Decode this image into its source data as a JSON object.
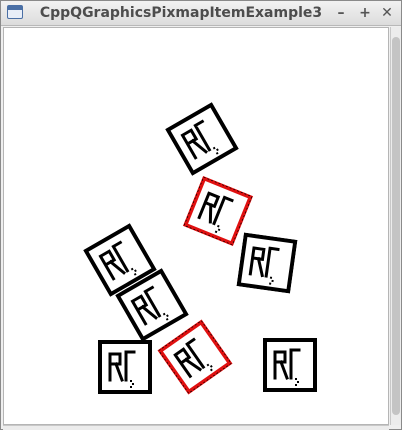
{
  "window": {
    "title": "CppQGraphicsPixmapItemExample3",
    "minimize_glyph": "–",
    "maximize_glyph": "+",
    "close_glyph": "✕"
  },
  "colors": {
    "item_border": "#000000",
    "selected_border": "#e01010",
    "canvas_bg": "#ffffff"
  },
  "scene": {
    "items": [
      {
        "name": "pixmap-item-1",
        "rotation": -30,
        "selected": false
      },
      {
        "name": "pixmap-item-2",
        "rotation": 22,
        "selected": true
      },
      {
        "name": "pixmap-item-3",
        "rotation": 8,
        "selected": false
      },
      {
        "name": "pixmap-item-4",
        "rotation": -30,
        "selected": false
      },
      {
        "name": "pixmap-item-5",
        "rotation": -30,
        "selected": false
      },
      {
        "name": "pixmap-item-6",
        "rotation": 0,
        "selected": false
      },
      {
        "name": "pixmap-item-7",
        "rotation": -35,
        "selected": true
      },
      {
        "name": "pixmap-item-8",
        "rotation": 0,
        "selected": false
      }
    ]
  }
}
